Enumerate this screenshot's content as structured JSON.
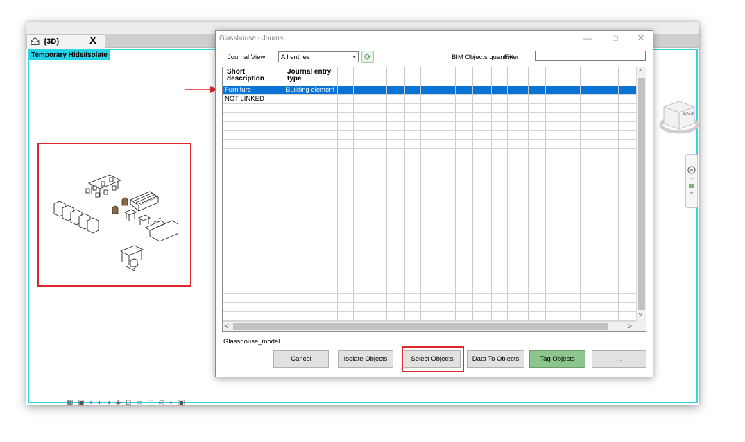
{
  "revit": {
    "view_tab": {
      "label": "{3D}",
      "close": "X",
      "icon": "house-3d-icon"
    },
    "temp_mode_badge": "Temporary Hide/Isolate",
    "colors": {
      "viewport_border": "#2fd6e6",
      "highlight": "#e0272b"
    }
  },
  "dialog": {
    "title": "Glasshouse - Journal",
    "window_buttons": {
      "minimize": "—",
      "maximize": "□",
      "close": "✕"
    },
    "journal_view_label": "Journal View",
    "journal_view_value": "All entries",
    "bim_quantity_label": "BIM Objects quantity",
    "filter_label": "Filter",
    "filter_value": "",
    "grid": {
      "columns": [
        "Short description",
        "Journal entry type"
      ],
      "rows": [
        {
          "short": "Furniture",
          "type": "Building element",
          "selected": true
        },
        {
          "short": "NOT LINKED",
          "type": "",
          "selected": false
        }
      ],
      "selection_color": "#0a74d6"
    },
    "model_name": "Glasshouse_model",
    "buttons": {
      "cancel": "Cancel",
      "isolate": "Isolate Objects",
      "select": "Select Objects",
      "data_to_objects": "Data To Objects",
      "tag": "Tag Objects",
      "more": "..."
    }
  }
}
